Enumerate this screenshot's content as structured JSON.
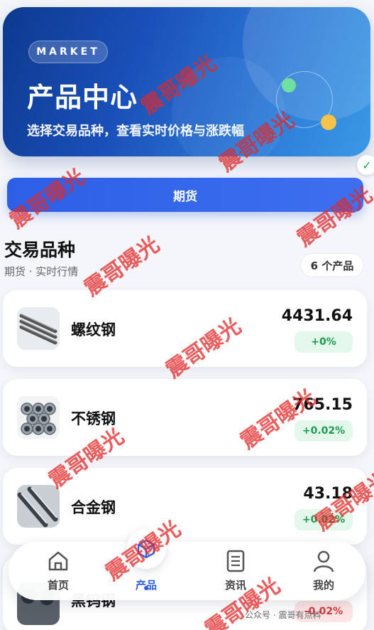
{
  "hero": {
    "badge": "MARKET",
    "title": "产品中心",
    "subtitle": "选择交易品种，查看实时价格与涨跌幅"
  },
  "tab": {
    "label": "期货"
  },
  "section": {
    "title": "交易品种",
    "subtitle": "期货 · 实时行情",
    "count": "6 个产品"
  },
  "products": [
    {
      "name": "螺纹钢",
      "price": "4431.64",
      "change": "+0%",
      "trend": "up"
    },
    {
      "name": "不锈钢",
      "price": "765.15",
      "change": "+0.02%",
      "trend": "up"
    },
    {
      "name": "合金钢",
      "price": "43.18",
      "change": "+0.02%",
      "trend": "up"
    },
    {
      "name": "黑钨钢",
      "price": "",
      "change": "-0.02%",
      "trend": "down"
    }
  ],
  "nav": {
    "home": "首页",
    "products": "产品",
    "news": "资讯",
    "mine": "我的"
  },
  "footer": {
    "note": "公众号 · 震哥有点料"
  },
  "watermark": "震哥曝光",
  "colors": {
    "accent": "#2c5fe6",
    "up": "#1c9b54",
    "down": "#d43c3c"
  }
}
